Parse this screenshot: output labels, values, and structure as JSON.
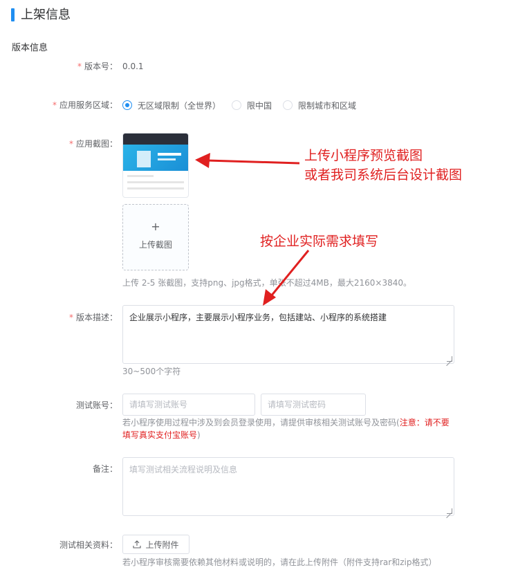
{
  "header": {
    "title": "上架信息"
  },
  "section": {
    "title": "版本信息"
  },
  "required_mark": "*",
  "version": {
    "label": "版本号：",
    "value": "0.0.1"
  },
  "service_area": {
    "label": "应用服务区域：",
    "options": [
      {
        "label": "无区域限制（全世界）",
        "checked": true
      },
      {
        "label": "限中国",
        "checked": false
      },
      {
        "label": "限制城市和区域",
        "checked": false
      }
    ]
  },
  "screenshots": {
    "label": "应用截图：",
    "upload_plus": "+",
    "upload_label": "上传截图",
    "hint": "上传 2-5 张截图，支持png、jpg格式，单张不超过4MB，最大2160×3840。"
  },
  "description": {
    "label": "版本描述：",
    "value": "企业展示小程序，主要展示小程序业务，包括建站、小程序的系统搭建",
    "counter": "30~500个字符"
  },
  "test_account": {
    "label": "测试账号：",
    "account_placeholder": "请填写测试账号",
    "password_placeholder": "请填写测试密码",
    "hint_prefix": "若小程序使用过程中涉及到会员登录使用，请提供审核相关测试账号及密码(",
    "hint_warn_line1": "注意：请不要",
    "hint_warn_line2": "填写真实支付宝账号",
    "hint_suffix": ")"
  },
  "remark": {
    "label": "备注：",
    "placeholder": "填写测试相关流程说明及信息"
  },
  "attachments": {
    "label": "测试相关资料：",
    "button": "上传附件",
    "hint": "若小程序审核需要依赖其他材料或说明的，请在此上传附件（附件支持rar和zip格式）"
  },
  "annotations": {
    "line1": "上传小程序预览截图",
    "line2": "或者我司系统后台设计截图",
    "line3": "按企业实际需求填写",
    "color": "#e02020"
  },
  "colors": {
    "accent": "#1f8ef1",
    "required": "#f56c6c"
  }
}
